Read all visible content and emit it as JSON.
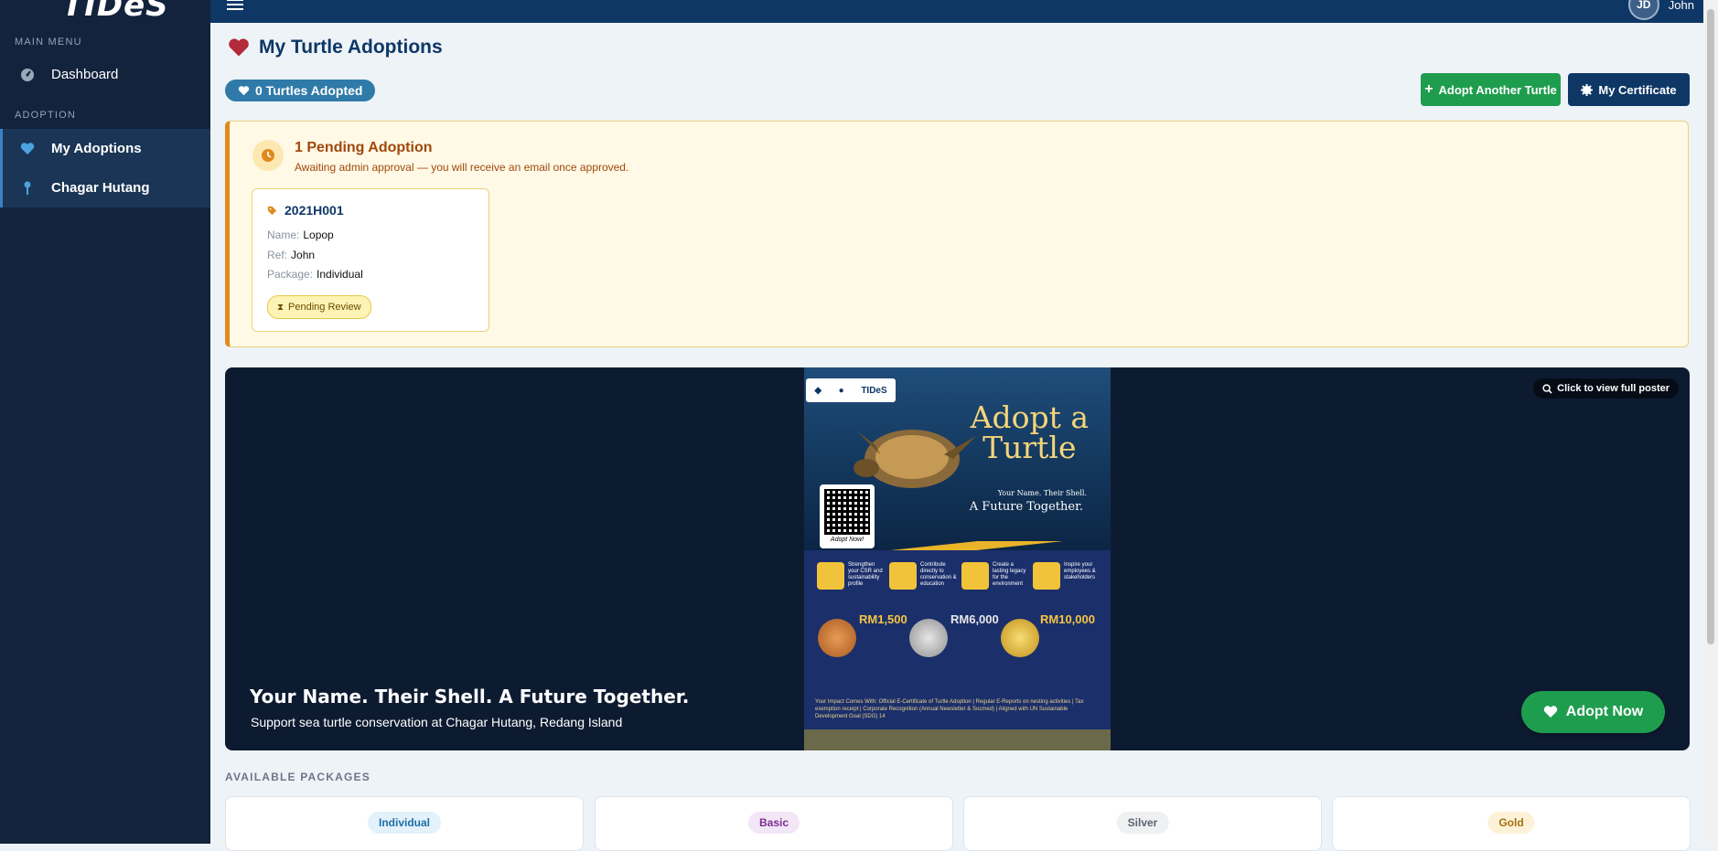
{
  "sidebar": {
    "logo": "TIDeS",
    "section_main": "MAIN MENU",
    "section_adoption": "ADOPTION",
    "items": [
      {
        "label": "Dashboard",
        "icon": "gauge-icon"
      },
      {
        "label": "My Adoptions",
        "icon": "heart-icon"
      },
      {
        "label": "Chagar Hutang",
        "icon": "pin-icon"
      }
    ]
  },
  "topbar": {
    "avatar": "JD",
    "user_name": "John"
  },
  "header": {
    "title": "My Turtle Adoptions",
    "adopted_count": "0 Turtles Adopted",
    "adopt_another": "Adopt Another Turtle",
    "my_certificate": "My Certificate"
  },
  "pending": {
    "title": "1 Pending Adoption",
    "subtitle": "Awaiting admin approval — you will receive an email once approved.",
    "card": {
      "code": "2021H001",
      "name_key": "Name:",
      "name": "Lopop",
      "ref_key": "Ref:",
      "ref": "John",
      "package_key": "Package:",
      "package": "Individual",
      "status": "Pending Review"
    }
  },
  "hero": {
    "zoom_hint": "Click to view full poster",
    "title": "Your Name. Their Shell. A Future Together.",
    "subtitle": "Support sea turtle conservation at Chagar Hutang, Redang Island",
    "adopt_now": "Adopt Now",
    "poster": {
      "heading_line1": "Adopt a",
      "heading_line2": "Turtle",
      "tagline": "Your Name. Their Shell.",
      "tagline2": "A Future Together.",
      "qr_caption": "Adopt Now!",
      "features": [
        "Strengthen your CSR and sustainability profile",
        "Contribute directly to conservation & education",
        "Create a lasting legacy for the environment",
        "Inspire your employees & stakeholders"
      ],
      "prices": [
        "RM1,500",
        "RM6,000",
        "RM10,000"
      ],
      "impact": "Your Impact Comes With: Official E-Certificate of Turtle Adoption | Regular E-Reports on nesting activities | Tax exemption receipt | Corporate Recognition (Annual Newsletter & Socmed) | Aligned with UN Sustainable Development Goal (SDG) 14"
    }
  },
  "packages": {
    "label": "AVAILABLE PACKAGES",
    "items": [
      {
        "name": "Individual",
        "bg": "#e3f1fb",
        "fg": "#1d6fa5"
      },
      {
        "name": "Basic",
        "bg": "#f3e6f7",
        "fg": "#7a2f8f"
      },
      {
        "name": "Silver",
        "bg": "#eef0f2",
        "fg": "#5b6470"
      },
      {
        "name": "Gold",
        "bg": "#fdf2d8",
        "fg": "#a6700c"
      }
    ]
  },
  "colors": {
    "navy": "#0e3766",
    "green": "#1f9d4f",
    "amber": "#e08a1e"
  }
}
